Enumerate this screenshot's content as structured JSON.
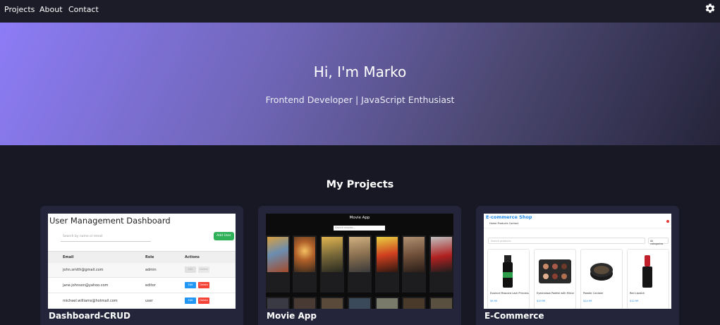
{
  "nav": {
    "links": [
      "Projects",
      "About",
      "Contact"
    ]
  },
  "hero": {
    "title": "Hi, I'm Marko",
    "subtitle": "Frontend Developer | JavaScript Enthusiast"
  },
  "projects_section": {
    "title": "My Projects",
    "cards": [
      {
        "title": "Dashboard-CRUD",
        "preview": {
          "heading": "User Management Dashboard",
          "search_placeholder": "Search by name or email",
          "add_label": "Add User",
          "columns": [
            "Email",
            "Role",
            "Actions"
          ],
          "rows": [
            {
              "email": "john.smith@gmail.com",
              "role": "admin"
            },
            {
              "email": "jane.johnson@yahoo.com",
              "role": "editor"
            },
            {
              "email": "michael.williams@hotmail.com",
              "role": "user"
            }
          ],
          "edit_label": "Edit",
          "delete_label": "Delete"
        }
      },
      {
        "title": "Movie App",
        "preview": {
          "heading": "Movie App",
          "search_placeholder": "Search movies..."
        }
      },
      {
        "title": "E-Commerce",
        "preview": {
          "heading": "E-commerce Shop",
          "nav_links": "Home    Products    Contact",
          "search_placeholder": "Search products",
          "select_value": "All categories",
          "products": [
            {
              "name": "Essence Mascara Lash Princess",
              "price": "$9.99"
            },
            {
              "name": "Eyeshadow Palette with Mirror",
              "price": "$19.99"
            },
            {
              "name": "Powder Canister",
              "price": "$14.99"
            },
            {
              "name": "Red Lipstick",
              "price": "$12.99"
            }
          ]
        }
      }
    ]
  },
  "colors": {
    "background": "#171824",
    "navbar": "#1c1c28",
    "card": "#24253a",
    "hero_gradient_start": "#8d7cf6",
    "hero_gradient_end": "#25243a"
  },
  "icons": {
    "settings": "gear-icon"
  }
}
